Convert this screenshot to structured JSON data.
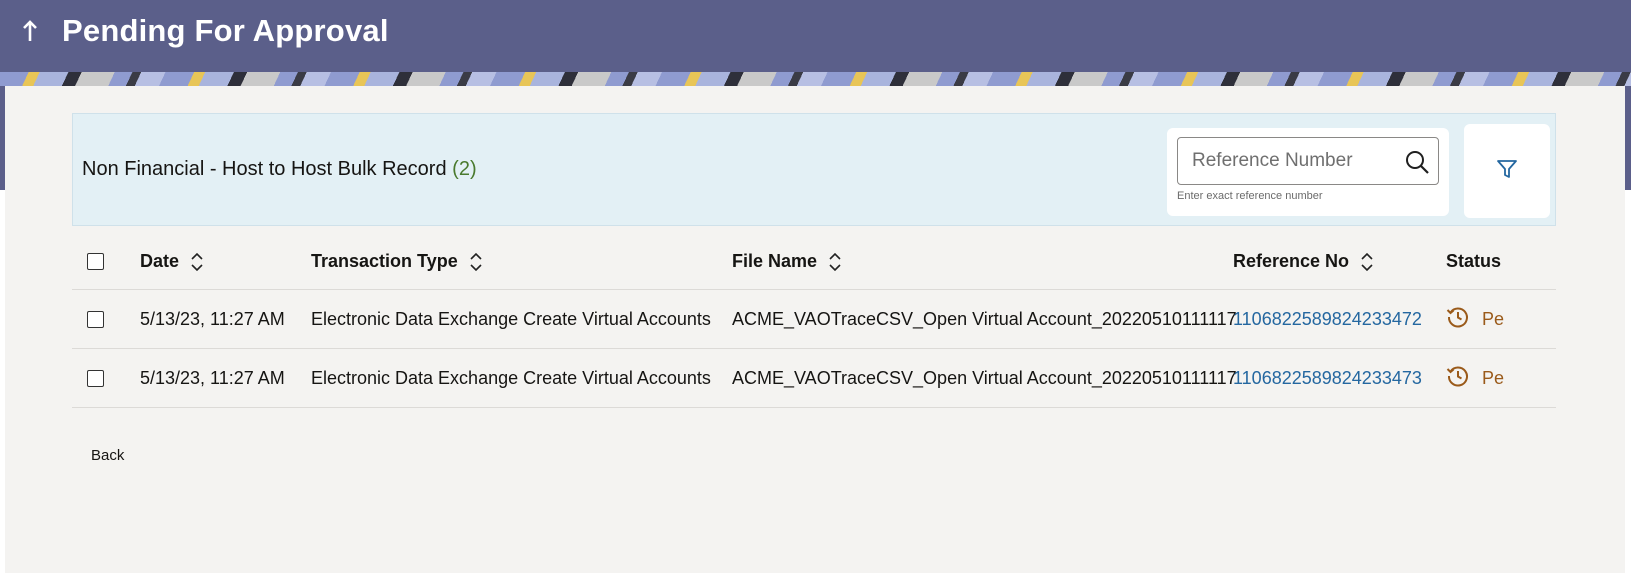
{
  "header": {
    "title": "Pending For Approval",
    "back_icon": "up-arrow-icon"
  },
  "toolbar": {
    "title": "Non Financial - Host to Host Bulk Record",
    "count": "(2)",
    "search": {
      "placeholder": "Reference Number",
      "value": "",
      "hint": "Enter exact reference number",
      "icon": "search-icon"
    },
    "filter_icon": "filter-icon"
  },
  "table": {
    "columns": {
      "date": "Date",
      "transaction_type": "Transaction Type",
      "file_name": "File Name",
      "reference_no": "Reference No",
      "status": "Status"
    },
    "rows": [
      {
        "date": "5/13/23, 11:27 AM",
        "transaction_type": "Electronic Data Exchange Create Virtual Accounts",
        "file_name": "ACME_VAOTraceCSV_Open Virtual Account_20220510111117",
        "reference_no": "1106822589824233472",
        "status": "Pe"
      },
      {
        "date": "5/13/23, 11:27 AM",
        "transaction_type": "Electronic Data Exchange Create Virtual Accounts",
        "file_name": "ACME_VAOTraceCSV_Open Virtual Account_20220510111117",
        "reference_no": "1106822589824233473",
        "status": "Pe"
      }
    ]
  },
  "footer": {
    "back_label": "Back"
  },
  "colors": {
    "header_bg": "#5b5f8a",
    "link": "#2467a0",
    "status": "#9a5a1a",
    "count": "#4a7a2e"
  }
}
